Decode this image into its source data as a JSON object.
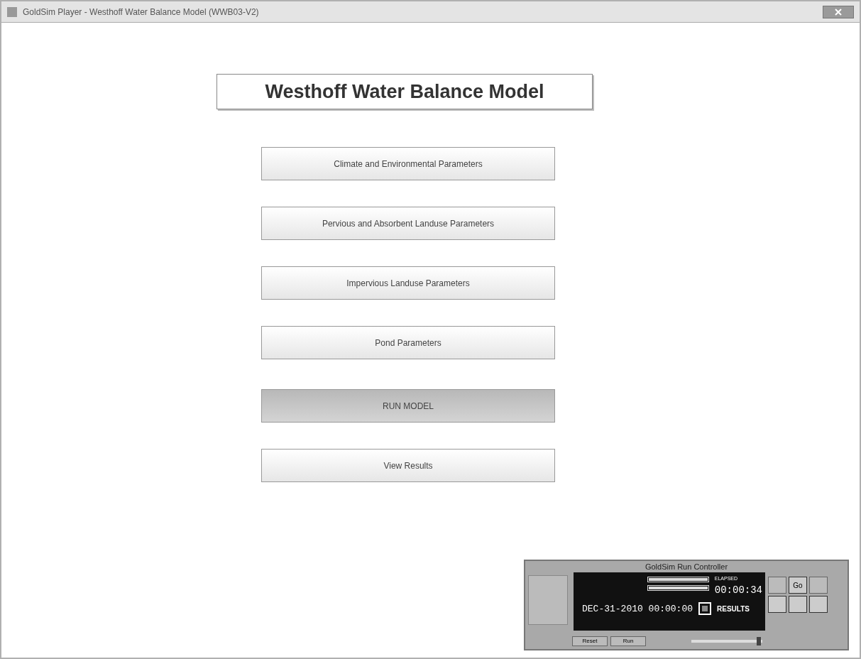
{
  "window": {
    "title": "GoldSim Player - Westhoff Water Balance Model (WWB03-V2)"
  },
  "heading": "Westhoff Water Balance Model",
  "buttons": [
    {
      "label": "Climate and Environmental Parameters",
      "highlighted": false
    },
    {
      "label": "Pervious and Absorbent Landuse Parameters",
      "highlighted": false
    },
    {
      "label": "Impervious Landuse Parameters",
      "highlighted": false
    },
    {
      "label": "Pond Parameters",
      "highlighted": false
    },
    {
      "label": "RUN MODEL",
      "highlighted": true
    },
    {
      "label": "View Results",
      "highlighted": false
    }
  ],
  "run_controller": {
    "title": "GoldSim Run Controller",
    "elapsed_label": "ELAPSED",
    "elapsed": "00:00:34",
    "sim_time": "DEC-31-2010 00:00:00",
    "status": "RESULTS",
    "progress": [
      {
        "level": 1
      },
      {
        "level": 1
      }
    ],
    "go_label": "Go",
    "speed": {
      "level": 0.95
    },
    "bottom_buttons": [
      "Reset",
      "Run"
    ]
  }
}
